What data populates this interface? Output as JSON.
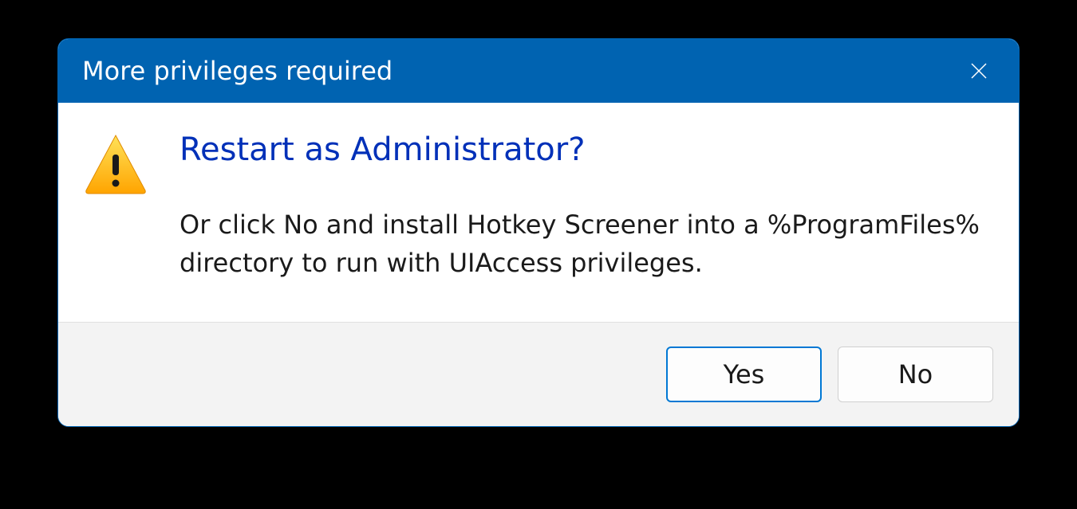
{
  "titlebar": {
    "title": "More privileges required"
  },
  "content": {
    "heading": "Restart as Administrator?",
    "body": "Or click No and install Hotkey Screener into a %ProgramFiles% directory to run with UIAccess privileges."
  },
  "footer": {
    "yes_label": "Yes",
    "no_label": "No"
  }
}
